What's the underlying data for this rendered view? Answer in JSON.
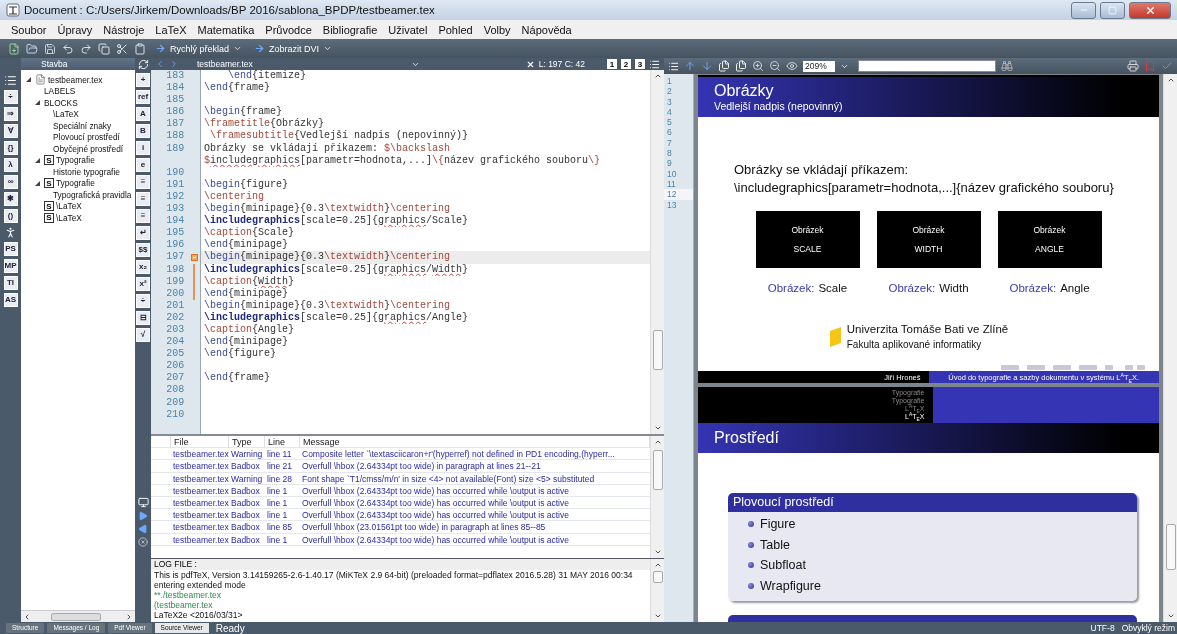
{
  "window": {
    "title": "Document : C:/Users/Jirkem/Downloads/BP 2016/sablona_BPDP/testbeamer.tex"
  },
  "menu": [
    "Soubor",
    "Úpravy",
    "Nástroje",
    "LaTeX",
    "Matematika",
    "Průvodce",
    "Bibliografie",
    "Uživatel",
    "Pohled",
    "Volby",
    "Nápověda"
  ],
  "toolbar": {
    "quick_build": "Rychlý překlad",
    "view": "Zobrazit DVI"
  },
  "left_tools": [
    {
      "kind": "list"
    },
    {
      "kind": "glyph",
      "label": "÷"
    },
    {
      "kind": "glyph",
      "label": "⇒"
    },
    {
      "kind": "glyph",
      "label": "∀"
    },
    {
      "kind": "glyph",
      "label": "{}"
    },
    {
      "kind": "glyph",
      "label": "λ"
    },
    {
      "kind": "glyph",
      "label": "∞"
    },
    {
      "kind": "glyph",
      "label": "✱"
    },
    {
      "kind": "glyph",
      "label": "()"
    },
    {
      "kind": "figure"
    },
    {
      "kind": "glyph",
      "label": "PS"
    },
    {
      "kind": "glyph",
      "label": "MP"
    },
    {
      "kind": "glyph",
      "label": "TI"
    },
    {
      "kind": "glyph",
      "label": "AS"
    }
  ],
  "structure": {
    "title": "Stavba",
    "tree": [
      {
        "label": "testbeamer.tex",
        "kind": "file",
        "expanded": true,
        "children": [
          {
            "label": "LABELS",
            "kind": "label"
          },
          {
            "label": "BLOCKS",
            "kind": "label",
            "expanded": true,
            "children": [
              {
                "label": "\\LaTeX",
                "kind": "label"
              },
              {
                "label": "Speciální znaky",
                "kind": "label"
              },
              {
                "label": "Plovoucí prostředí",
                "kind": "label"
              },
              {
                "label": "Obyčejné prostředí",
                "kind": "label"
              }
            ]
          },
          {
            "label": "Typografie",
            "kind": "section",
            "badge": "S",
            "expanded": true,
            "children": [
              {
                "label": "Historie typografie",
                "kind": "label"
              }
            ]
          },
          {
            "label": "Typografie",
            "kind": "section",
            "badge": "S",
            "expanded": true,
            "children": [
              {
                "label": "Typografická pravidla",
                "kind": "label"
              }
            ]
          },
          {
            "label": "\\LaTeX",
            "kind": "section",
            "badge": "S"
          },
          {
            "label": "\\LaTeX",
            "kind": "section",
            "badge": "S"
          }
        ]
      }
    ]
  },
  "mid_tools": [
    "+",
    "ref",
    "A",
    "B",
    "i",
    "e",
    "≡",
    "≡",
    "≡",
    "↵",
    "$$",
    "x₂",
    "x²",
    "÷",
    "⊟",
    "√"
  ],
  "editor": {
    "file": "testbeamer.tex",
    "position": "L: 197 C: 42",
    "views": [
      "1",
      "2",
      "3"
    ],
    "lines": [
      {
        "number": "183",
        "current": false,
        "segments": [
          {
            "kind": "env",
            "text": "    \\end"
          },
          {
            "kind": "plain",
            "text": "{itemize}"
          }
        ]
      },
      {
        "number": "184",
        "current": false,
        "segments": [
          {
            "kind": "env",
            "text": "\\end"
          },
          {
            "kind": "plain",
            "text": "{frame}"
          }
        ]
      },
      {
        "number": "185",
        "current": false
      },
      {
        "number": "186",
        "current": false,
        "segments": [
          {
            "kind": "env",
            "text": "\\begin"
          },
          {
            "kind": "plain",
            "text": "{frame}"
          }
        ]
      },
      {
        "number": "187",
        "current": false,
        "segments": [
          {
            "kind": "cmd",
            "text": "\\frametitle"
          },
          {
            "kind": "plain",
            "text": "{Obrázky}"
          }
        ]
      },
      {
        "number": "188",
        "current": false,
        "segments": [
          {
            "kind": "cmd",
            "text": " \\framesubtitle"
          },
          {
            "kind": "plain",
            "text": "{Vedlejší nadpis (nepovinný)}"
          }
        ]
      },
      {
        "number": "189",
        "current": false,
        "segments": [
          {
            "kind": "plain",
            "text": "Obrázky se vkládají příkazem: "
          },
          {
            "kind": "cmd",
            "text": "$\\backslash"
          }
        ]
      },
      {
        "current": false,
        "segments": [
          {
            "kind": "cmd",
            "text": "$"
          },
          {
            "kind": "typo",
            "text": "includegraphics"
          },
          {
            "kind": "plain",
            "text": "[parametr=hodnota,...]"
          },
          {
            "kind": "cmd",
            "text": "\\{"
          },
          {
            "kind": "plain",
            "text": "název grafického souboru"
          },
          {
            "kind": "cmd",
            "text": "\\}"
          }
        ]
      },
      {
        "number": "190",
        "current": false
      },
      {
        "number": "191",
        "current": false,
        "segments": [
          {
            "kind": "env",
            "text": "\\begin"
          },
          {
            "kind": "plain",
            "text": "{figure}"
          }
        ]
      },
      {
        "number": "192",
        "current": false,
        "segments": [
          {
            "kind": "cmd",
            "text": "\\centering"
          }
        ]
      },
      {
        "number": "193",
        "current": false,
        "segments": [
          {
            "kind": "env",
            "text": "\\begin"
          },
          {
            "kind": "plain",
            "text": "{minipage}{0.3"
          },
          {
            "kind": "cmd",
            "text": "\\textwidth"
          },
          {
            "kind": "plain",
            "text": "}"
          },
          {
            "kind": "cmd",
            "text": "\\centering"
          }
        ]
      },
      {
        "number": "194",
        "current": false,
        "segments": [
          {
            "kind": "strong",
            "text": "\\includegraphics"
          },
          {
            "kind": "plain",
            "text": "[scale=0.25]{"
          },
          {
            "kind": "typo",
            "text": "graphics"
          },
          {
            "kind": "plain",
            "text": "/Scale}"
          }
        ]
      },
      {
        "number": "195",
        "current": false,
        "segments": [
          {
            "kind": "cmd",
            "text": "\\caption"
          },
          {
            "kind": "plain",
            "text": "{Scale}"
          }
        ]
      },
      {
        "number": "196",
        "current": false,
        "segments": [
          {
            "kind": "env",
            "text": "\\end"
          },
          {
            "kind": "plain",
            "text": "{minipage}"
          }
        ]
      },
      {
        "number": "197",
        "current": true,
        "fold": {
          "kind": "start"
        },
        "segments": [
          {
            "kind": "env",
            "text": "\\begin"
          },
          {
            "kind": "plain",
            "text": "{minipage}{0.3"
          },
          {
            "kind": "cmd",
            "text": "\\textwidth"
          },
          {
            "kind": "plain",
            "text": "}"
          },
          {
            "kind": "cmd",
            "text": "\\centering"
          }
        ]
      },
      {
        "number": "198",
        "current": false,
        "fold": {
          "kind": "inside"
        },
        "segments": [
          {
            "kind": "strong",
            "text": "\\includegraphics"
          },
          {
            "kind": "plain",
            "text": "[scale=0.25]{"
          },
          {
            "kind": "typo",
            "text": "graphics"
          },
          {
            "kind": "plain",
            "text": "/"
          },
          {
            "kind": "typo",
            "text": "Width"
          },
          {
            "kind": "plain",
            "text": "}"
          }
        ]
      },
      {
        "number": "199",
        "current": false,
        "fold": {
          "kind": "inside"
        },
        "segments": [
          {
            "kind": "cmd",
            "text": "\\caption"
          },
          {
            "kind": "plain",
            "text": "{"
          },
          {
            "kind": "typo",
            "text": "Width"
          },
          {
            "kind": "plain",
            "text": "}"
          }
        ]
      },
      {
        "number": "200",
        "current": false,
        "fold": {
          "kind": "inside"
        },
        "segments": [
          {
            "kind": "env",
            "text": "\\end"
          },
          {
            "kind": "plain",
            "text": "{minipage}"
          }
        ]
      },
      {
        "number": "201",
        "current": false,
        "segments": [
          {
            "kind": "env",
            "text": "\\begin"
          },
          {
            "kind": "plain",
            "text": "{minipage}{0.3"
          },
          {
            "kind": "cmd",
            "text": "\\textwidth"
          },
          {
            "kind": "plain",
            "text": "}"
          },
          {
            "kind": "cmd",
            "text": "\\centering"
          }
        ]
      },
      {
        "number": "202",
        "current": false,
        "segments": [
          {
            "kind": "strong",
            "text": "\\includegraphics"
          },
          {
            "kind": "plain",
            "text": "[scale=0.25]{"
          },
          {
            "kind": "typo",
            "text": "graphics"
          },
          {
            "kind": "plain",
            "text": "/Angle}"
          }
        ]
      },
      {
        "number": "203",
        "current": false,
        "segments": [
          {
            "kind": "cmd",
            "text": "\\caption"
          },
          {
            "kind": "plain",
            "text": "{Angle}"
          }
        ]
      },
      {
        "number": "204",
        "current": false,
        "segments": [
          {
            "kind": "env",
            "text": "\\end"
          },
          {
            "kind": "plain",
            "text": "{minipage}"
          }
        ]
      },
      {
        "number": "205",
        "current": false,
        "segments": [
          {
            "kind": "env",
            "text": "\\end"
          },
          {
            "kind": "plain",
            "text": "{figure}"
          }
        ]
      },
      {
        "number": "206",
        "current": false
      },
      {
        "number": "207",
        "current": false,
        "segments": [
          {
            "kind": "env",
            "text": "\\end"
          },
          {
            "kind": "plain",
            "text": "{frame}"
          }
        ]
      },
      {
        "number": "208",
        "current": false
      },
      {
        "number": "209",
        "current": false
      },
      {
        "number": "210",
        "current": false
      }
    ]
  },
  "messages": {
    "columns": [
      "File",
      "Type",
      "Line",
      "Message"
    ],
    "rows": [
      {
        "file": "testbeamer.tex",
        "type": "Warning",
        "line": "line 11",
        "message": "Composite letter `\\textasciicaron+r'(hyperref) not defined in PD1 encoding,(hyperr..."
      },
      {
        "file": "testbeamer.tex",
        "type": "Badbox",
        "line": "line 21",
        "message": "Overfull \\hbox (2.64334pt too wide) in paragraph at lines 21--21"
      },
      {
        "file": "testbeamer.tex",
        "type": "Warning",
        "line": "line 28",
        "message": "Font shape `T1/cmss/m/n' in size <4> not available(Font) size <5> substituted"
      },
      {
        "file": "testbeamer.tex",
        "type": "Badbox",
        "line": "line 1",
        "message": "Overfull \\hbox (2.64334pt too wide) has occurred while \\output is active"
      },
      {
        "file": "testbeamer.tex",
        "type": "Badbox",
        "line": "line 1",
        "message": "Overfull \\hbox (2.64334pt too wide) has occurred while \\output is active"
      },
      {
        "file": "testbeamer.tex",
        "type": "Badbox",
        "line": "line 1",
        "message": "Overfull \\hbox (2.64334pt too wide) has occurred while \\output is active"
      },
      {
        "file": "testbeamer.tex",
        "type": "Badbox",
        "line": "line 85",
        "message": "Overfull \\hbox (23.01561pt too wide) in paragraph at lines 85--85"
      },
      {
        "file": "testbeamer.tex",
        "type": "Badbox",
        "line": "line 1",
        "message": "Overfull \\hbox (2.64334pt too wide) has occurred while \\output is active"
      }
    ]
  },
  "log": {
    "title": "LOG FILE :",
    "lines": [
      {
        "kind": "plain",
        "text": "This is pdfTeX, Version 3.14159265-2.6-1.40.17 (MiKTeX 2.9 64-bit) (preloaded format=pdflatex 2016.5.28) 31 MAY 2016 00:34"
      },
      {
        "kind": "plain",
        "text": "entering extended mode"
      },
      {
        "kind": "file",
        "text": "**./testbeamer.tex"
      },
      {
        "kind": "file",
        "text": "(testbeamer.tex"
      },
      {
        "kind": "plain",
        "text": "LaTeX2e <2016/03/31>"
      }
    ]
  },
  "preview": {
    "zoom": "209%",
    "pages": [
      {
        "label": "1",
        "selected": false
      },
      {
        "label": "2",
        "selected": false
      },
      {
        "label": "3",
        "selected": false
      },
      {
        "label": "4",
        "selected": false
      },
      {
        "label": "5",
        "selected": false
      },
      {
        "label": "6",
        "selected": false
      },
      {
        "label": "7",
        "selected": false
      },
      {
        "label": "8",
        "selected": false
      },
      {
        "label": "9",
        "selected": false
      },
      {
        "label": "10",
        "selected": false
      },
      {
        "label": "11",
        "selected": false
      },
      {
        "label": "12",
        "selected": true
      },
      {
        "label": "13",
        "selected": false
      }
    ],
    "slide_1": {
      "title": "Obrázky",
      "subtitle": "Vedlejší nadpis (nepovinný)",
      "text": [
        "Obrázky se vkládají příkazem:",
        "\\includegraphics[parametr=hodnota,...]{název grafického souboru}"
      ],
      "figures": [
        {
          "image_lines": [
            "Obrázek",
            "SCALE"
          ],
          "caption_label": "Obrázek:",
          "caption": "Scale"
        },
        {
          "image_lines": [
            "Obrázek",
            "WIDTH"
          ],
          "caption_label": "Obrázek:",
          "caption": "Width"
        },
        {
          "image_lines": [
            "Obrázek",
            "ANGLE"
          ],
          "caption_label": "Obrázek:",
          "caption": "Angle"
        }
      ],
      "logo": [
        "Univerzita Tomáše Bati ve Zlíně",
        "Fakulta aplikované informatiky"
      ],
      "footer_author": "Jiří Hroneš",
      "footer_title": "Úvod do typografie a sazby dokumentu v systému L$^{A}$T$_{E}$X."
    },
    "slide_2": {
      "sections": [
        {
          "label": "Typografie",
          "selected": false
        },
        {
          "label": "Typografie",
          "selected": false
        },
        {
          "label": "L$^{A}$T$_{E}$X",
          "selected": false
        },
        {
          "label": "L$^{A}$T$_{E}$X",
          "selected": true
        }
      ],
      "title": "Prostředí",
      "block": {
        "title": "Plovoucí prostředí",
        "items": [
          "Figure",
          "Table",
          "Subfloat",
          "Wrapfigure"
        ]
      }
    }
  },
  "status_bar": {
    "tabs": [
      {
        "label": "Structure",
        "selected": false
      },
      {
        "label": "Messages / Log",
        "selected": false
      },
      {
        "label": "Pdf Viewer",
        "selected": false
      },
      {
        "label": "Source Viewer",
        "selected": true
      }
    ],
    "status": "Ready",
    "encoding": "UTF-8",
    "mode": "Obvyklý režim"
  }
}
